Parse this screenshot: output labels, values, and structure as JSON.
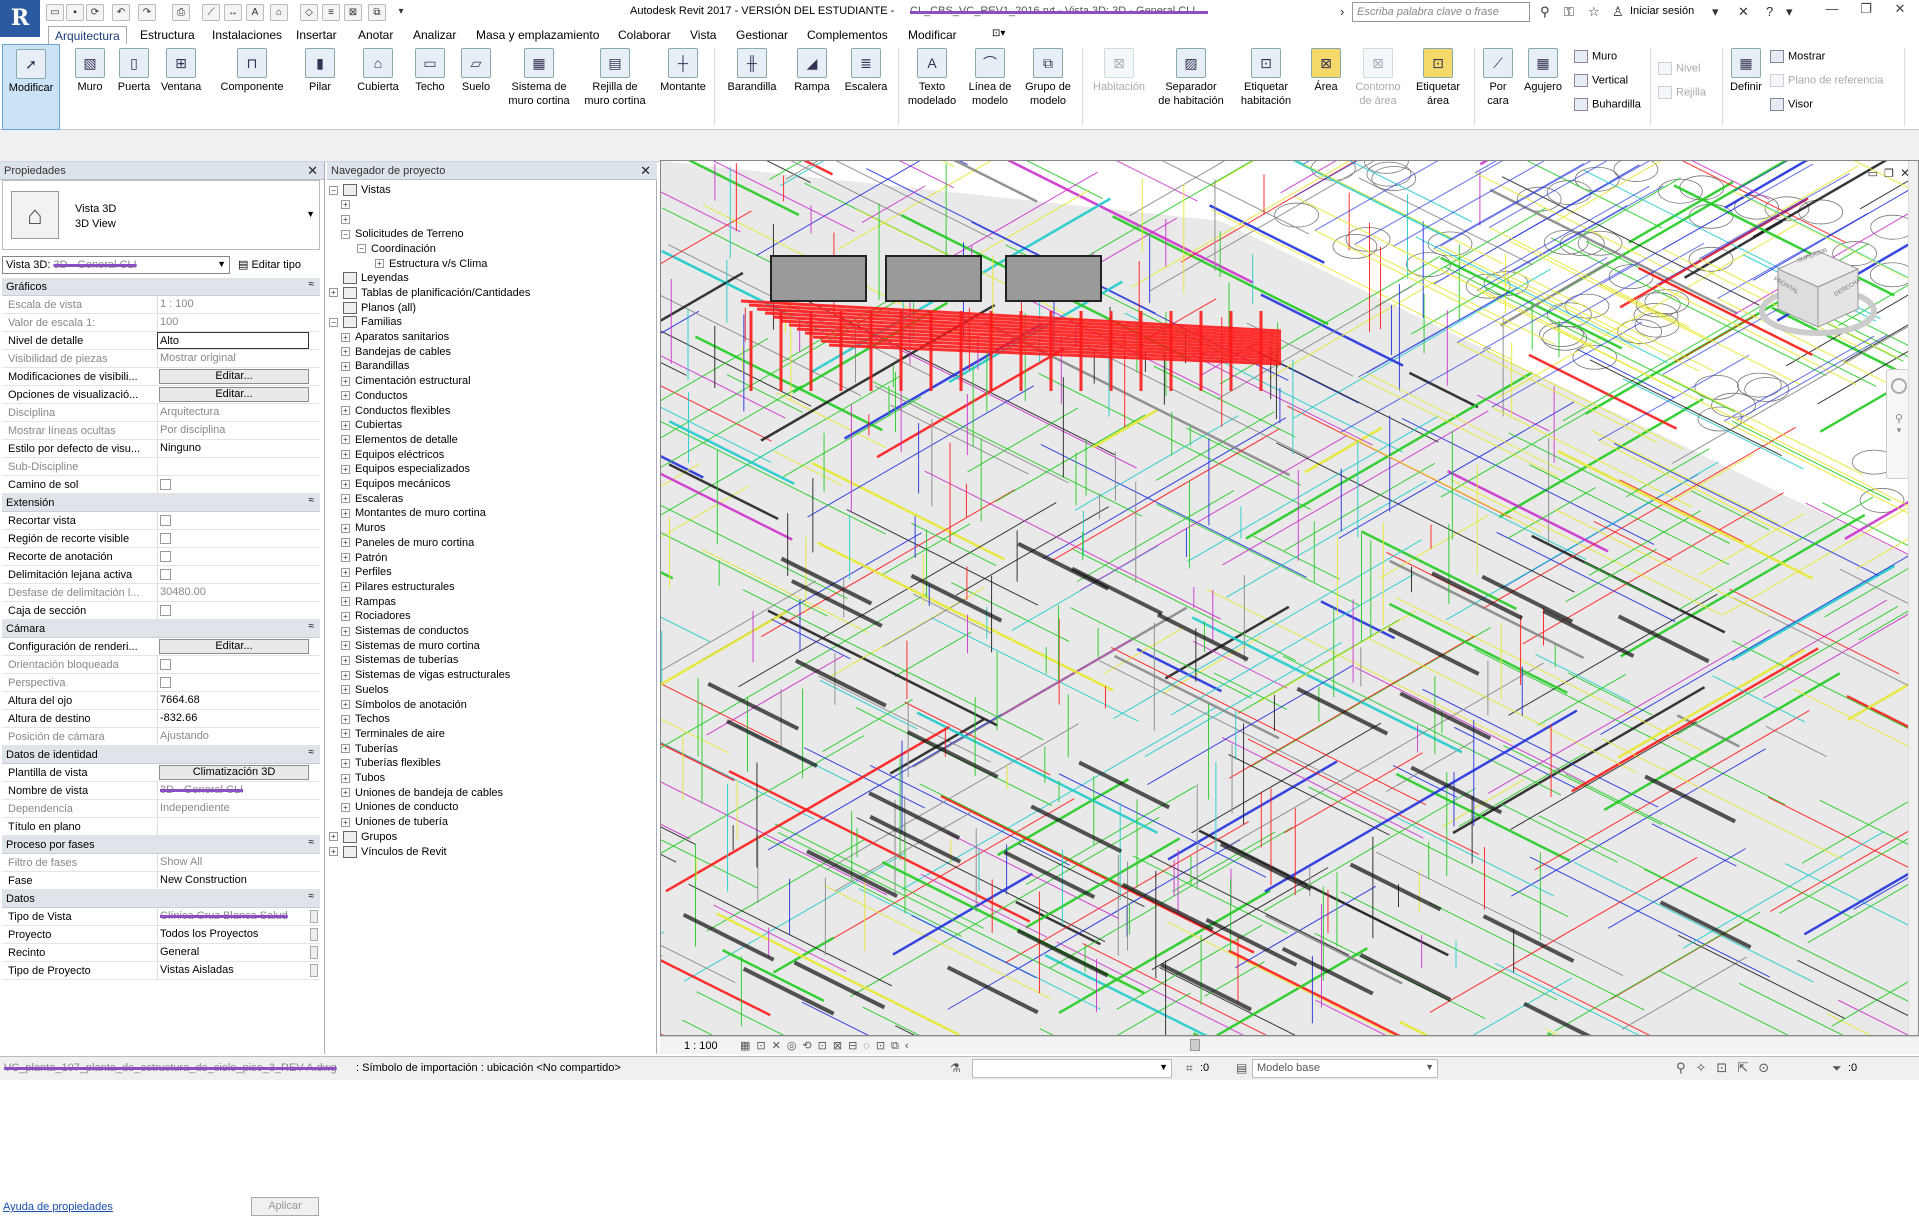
{
  "app": {
    "logo": "R",
    "title": "Autodesk Revit 2017 - VERSIÓN DEL ESTUDIANTE -",
    "title_redacted": "CL_CBS_VC_REV1_2016.rvt - Vista 3D: 3D - General CLI",
    "search_placeholder": "Escriba palabra clave o frase",
    "login": "Iniciar sesión"
  },
  "tabs": [
    "Arquitectura",
    "Estructura",
    "Instalaciones",
    "Insertar",
    "Anotar",
    "Analizar",
    "Masa y emplazamiento",
    "Colaborar",
    "Vista",
    "Gestionar",
    "Complementos",
    "Modificar"
  ],
  "ribbon": {
    "modificar": "Modificar",
    "muro": "Muro",
    "puerta": "Puerta",
    "ventana": "Ventana",
    "componente": "Componente",
    "pilar": "Pilar",
    "cubierta": "Cubierta",
    "techo": "Techo",
    "suelo": "Suelo",
    "sistema_muro_cortina": [
      "Sistema de",
      "muro cortina"
    ],
    "rejilla_muro_cortina": [
      "Rejilla de",
      "muro cortina"
    ],
    "montante": "Montante",
    "barandilla": "Barandilla",
    "rampa": "Rampa",
    "escalera": "Escalera",
    "texto_modelado": [
      "Texto",
      "modelado"
    ],
    "linea_modelo": [
      "Línea de",
      "modelo"
    ],
    "grupo_modelo": [
      "Grupo de",
      "modelo"
    ],
    "habitacion": "Habitación",
    "separador_habitacion": [
      "Separador",
      "de habitación"
    ],
    "etiquetar_habitacion": [
      "Etiquetar",
      "habitación"
    ],
    "area": "Área",
    "contorno_area": [
      "Contorno",
      "de área"
    ],
    "etiquetar_area": [
      "Etiquetar",
      "área"
    ],
    "por_cara": [
      "Por",
      "cara"
    ],
    "agujero": "Agujero",
    "hueco_muro": "Muro",
    "hueco_vertical": "Vertical",
    "buhardilla": "Buhardilla",
    "nivel": "Nivel",
    "rejilla": "Rejilla",
    "definir": "Definir",
    "mostrar": "Mostrar",
    "plano_referencia": "Plano de referencia",
    "visor": "Visor"
  },
  "properties": {
    "panel_title": "Propiedades",
    "type_name": "Vista 3D",
    "type_sub": "3D View",
    "view_selector_prefix": "Vista 3D:",
    "view_selector_redacted": "3D - General CLI",
    "edit_type": "Editar tipo",
    "sections": [
      {
        "title": "Gráficos",
        "rows": [
          {
            "k": "Escala de vista",
            "v": "1 : 100",
            "ro": true
          },
          {
            "k": "Valor de escala    1:",
            "v": "100",
            "ro": true
          },
          {
            "k": "Nivel de detalle",
            "v": "Alto",
            "input": true
          },
          {
            "k": "Visibilidad de piezas",
            "v": "Mostrar original",
            "ro": true
          },
          {
            "k": "Modificaciones de visibili...",
            "btn": "Editar..."
          },
          {
            "k": "Opciones de visualizació...",
            "btn": "Editar..."
          },
          {
            "k": "Disciplina",
            "v": "Arquitectura",
            "ro": true
          },
          {
            "k": "Mostrar líneas ocultas",
            "v": "Por disciplina",
            "ro": true
          },
          {
            "k": "Estilo por defecto de visu...",
            "v": "Ninguno"
          },
          {
            "k": "Sub-Discipline",
            "v": "",
            "ro": true
          },
          {
            "k": "Camino de sol",
            "chk": true
          }
        ]
      },
      {
        "title": "Extensión",
        "rows": [
          {
            "k": "Recortar vista",
            "chk": true
          },
          {
            "k": "Región de recorte visible",
            "chk": true
          },
          {
            "k": "Recorte de anotación",
            "chk": true
          },
          {
            "k": "Delimitación lejana activa",
            "chk": true
          },
          {
            "k": "Desfase de delimitación l...",
            "v": "30480.00",
            "ro": true
          },
          {
            "k": "Caja de sección",
            "chk": true
          }
        ]
      },
      {
        "title": "Cámara",
        "rows": [
          {
            "k": "Configuración de renderi...",
            "btn": "Editar..."
          },
          {
            "k": "Orientación bloqueada",
            "chk": true,
            "ro": true
          },
          {
            "k": "Perspectiva",
            "chk": true,
            "ro": true
          },
          {
            "k": "Altura del ojo",
            "v": "7664.68"
          },
          {
            "k": "Altura de destino",
            "v": "-832.66"
          },
          {
            "k": "Posición de cámara",
            "v": "Ajustando",
            "ro": true
          }
        ]
      },
      {
        "title": "Datos de identidad",
        "rows": [
          {
            "k": "Plantilla de vista",
            "btn": "Climatización 3D"
          },
          {
            "k": "Nombre de vista",
            "v": "3D - General CLI",
            "redacted": true
          },
          {
            "k": "Dependencia",
            "v": "Independiente",
            "ro": true
          },
          {
            "k": "Título en plano",
            "v": ""
          }
        ]
      },
      {
        "title": "Proceso por fases",
        "rows": [
          {
            "k": "Filtro de fases",
            "v": "Show All",
            "ro": true
          },
          {
            "k": "Fase",
            "v": "New Construction"
          }
        ]
      },
      {
        "title": "Datos",
        "rows": [
          {
            "k": "Tipo de Vista",
            "v": "Clínica Cruz Blanca Salud",
            "redacted": true,
            "sc": true
          },
          {
            "k": "Proyecto",
            "v": "Todos los Proyectos",
            "sc": true
          },
          {
            "k": "Recinto",
            "v": "General",
            "sc": true
          },
          {
            "k": "Tipo de Proyecto",
            "v": "Vistas Aisladas",
            "sc": true
          }
        ]
      }
    ],
    "help_link": "Ayuda de propiedades",
    "apply": "Aplicar"
  },
  "browser": {
    "panel_title": "Navegador de proyecto",
    "top": [
      "Vistas"
    ],
    "solicitudes": "Solicitudes de Terreno",
    "coordinacion": "Coordinación",
    "estructura_clima": "Estructura v/s Clima",
    "leyendas": "Leyendas",
    "tablas": "Tablas de planificación/Cantidades",
    "planos": "Planos (all)",
    "familias": "Familias",
    "family_items": [
      "Aparatos sanitarios",
      "Bandejas de cables",
      "Barandillas",
      "Cimentación estructural",
      "Conductos",
      "Conductos flexibles",
      "Cubiertas",
      "Elementos de detalle",
      "Equipos eléctricos",
      "Equipos especializados",
      "Equipos mecánicos",
      "Escaleras",
      "Montantes de muro cortina",
      "Muros",
      "Paneles de muro cortina",
      "Patrón",
      "Perfiles",
      "Pilares estructurales",
      "Rampas",
      "Rociadores",
      "Sistemas de conductos",
      "Sistemas de muro cortina",
      "Sistemas de tuberías",
      "Sistemas de vigas estructurales",
      "Suelos",
      "Símbolos de anotación",
      "Techos",
      "Terminales de aire",
      "Tuberías",
      "Tuberías flexibles",
      "Tubos",
      "Uniones de bandeja de cables",
      "Uniones de conducto",
      "Uniones de tubería"
    ],
    "grupos": "Grupos",
    "vinculos": "Vínculos de Revit"
  },
  "viewport": {
    "scale": "1 : 100",
    "viewcube_top": "SUPERIOR",
    "viewcube_left": "FRONTAL",
    "viewcube_right": "DERECHA"
  },
  "status": {
    "redacted_prefix": "VC_planta_107_planta_de_estructura_de_cielo_piso_3_REV A.dwg",
    "text": ": Símbolo de importación : ubicación <No compartido>",
    "zero": ":0",
    "model": "Modelo base"
  },
  "colors": {
    "accent": "#2c5aa0",
    "redact": "#8a4fc2",
    "pipe_red": "#ff1a1a",
    "pipe_green": "#22cc22",
    "pipe_magenta": "#cc33cc",
    "pipe_cyan": "#22cccc",
    "pipe_yellow": "#e8e830",
    "pipe_blue": "#2233dd"
  }
}
